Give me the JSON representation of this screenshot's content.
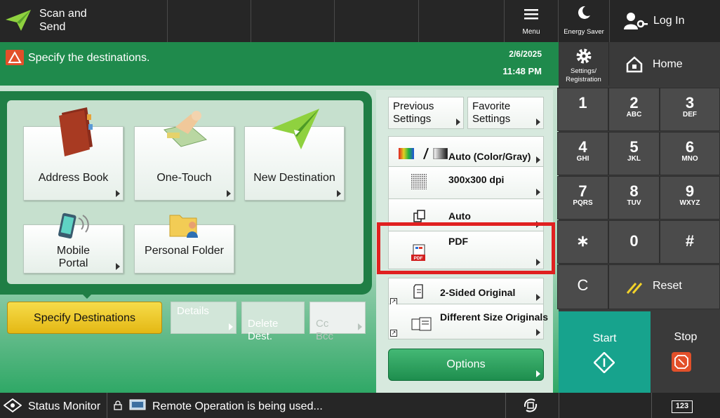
{
  "app": {
    "title": "Scan and\nSend",
    "message": "Specify the destinations.",
    "date": "2/6/2025",
    "time": "11:48 PM"
  },
  "topbar": {
    "menu_label": "Menu",
    "energy_saver_label": "Energy Saver",
    "login_label": "Log In",
    "settings_label": "Settings/\nRegistration",
    "home_label": "Home"
  },
  "destinations": {
    "address_book": "Address Book",
    "one_touch": "One-Touch",
    "new_destination": "New Destination",
    "mobile_portal": "Mobile\nPortal",
    "personal_folder": "Personal Folder"
  },
  "actions": {
    "specify_destinations": "Specify Destinations",
    "details": "Details",
    "delete_dest": "Delete\nDest.",
    "cc_bcc": "Cc\nBcc"
  },
  "settings": {
    "previous": "Previous\nSettings",
    "favorite": "Favorite\nSettings",
    "color": "Auto (Color/Gray)",
    "resolution": "300x300 dpi",
    "size": "Auto",
    "file_format": "PDF",
    "two_sided": "2-Sided Original",
    "diff_size": "Different Size Originals",
    "options": "Options"
  },
  "keypad": {
    "keys": [
      {
        "n": "1",
        "s": ""
      },
      {
        "n": "2",
        "s": "ABC"
      },
      {
        "n": "3",
        "s": "DEF"
      },
      {
        "n": "4",
        "s": "GHI"
      },
      {
        "n": "5",
        "s": "JKL"
      },
      {
        "n": "6",
        "s": "MNO"
      },
      {
        "n": "7",
        "s": "PQRS"
      },
      {
        "n": "8",
        "s": "TUV"
      },
      {
        "n": "9",
        "s": "WXYZ"
      },
      {
        "n": "∗",
        "s": ""
      },
      {
        "n": "0",
        "s": ""
      },
      {
        "n": "#",
        "s": ""
      }
    ],
    "clear": "C",
    "reset": "Reset",
    "start": "Start",
    "stop": "Stop"
  },
  "statusbar": {
    "status_monitor": "Status Monitor",
    "remote_message": "Remote Operation is being used...",
    "counter_label": "123"
  },
  "colors": {
    "header_green": "#1f8a4c",
    "start_teal": "#17a38d",
    "stop_orange": "#e2502a",
    "highlight_red": "#e02020",
    "specify_yellow": "#e9c21b"
  }
}
